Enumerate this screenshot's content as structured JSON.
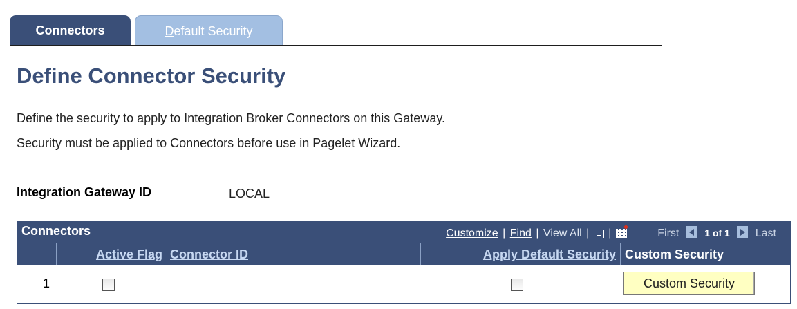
{
  "tabs": [
    {
      "label": "Connectors",
      "active": true
    },
    {
      "label_prefix": "D",
      "label_rest": "efault Security",
      "active": false
    }
  ],
  "page": {
    "title": "Define Connector Security",
    "description_line1": "Define the security to apply to Integration Broker Connectors on this Gateway.",
    "description_line2": "Security must be applied to Connectors before use in Pagelet Wizard."
  },
  "gateway": {
    "label": "Integration Gateway ID",
    "value": "LOCAL"
  },
  "grid": {
    "title": "Connectors",
    "nav": {
      "customize": "Customize",
      "find": "Find",
      "view_all": "View All",
      "separator": "|",
      "first": "First",
      "count": "1 of 1",
      "last": "Last"
    },
    "columns": [
      "",
      "Active Flag",
      "Connector ID",
      "Apply Default Security",
      "Custom Security"
    ],
    "rows": [
      {
        "num": "1",
        "active_flag": false,
        "connector_id": "",
        "apply_default_security": false,
        "button_label": "Custom Security"
      }
    ]
  },
  "colors": {
    "header_bg": "#3a4f78",
    "inactive_tab_bg": "#a3bfe2",
    "button_bg": "#ffffc2"
  },
  "icons": [
    "zoom-icon",
    "spreadsheet-icon",
    "previous-arrow-icon",
    "next-arrow-icon"
  ]
}
